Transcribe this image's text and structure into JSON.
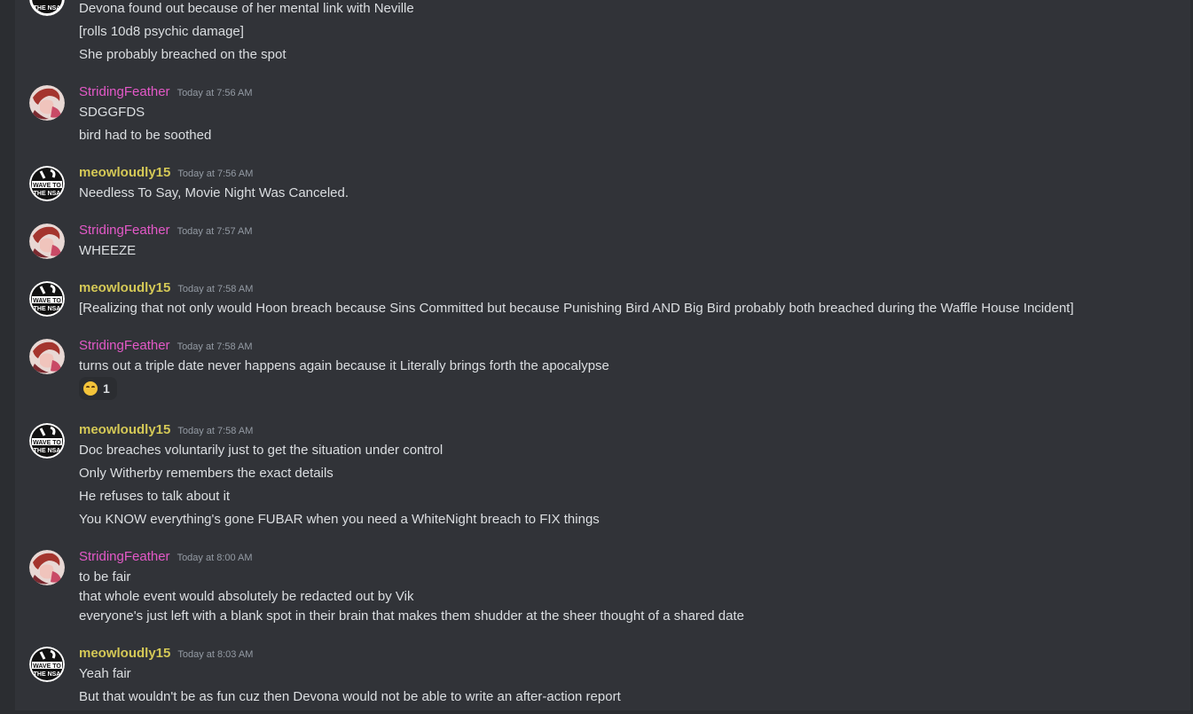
{
  "users": {
    "sf": "StridingFeather",
    "ml": "meowloudly15"
  },
  "avatars": {
    "nsa_badge_text": "WAVE TO THE NSA"
  },
  "colors": {
    "striding": "#e459c8",
    "meow": "#d4c856",
    "bg": "#313338"
  },
  "messages": [
    {
      "lines": [
        "Devona found out because of her mental link with Neville",
        "[rolls 10d8 psychic damage]",
        "She probably breached on the spot"
      ]
    },
    {
      "user": "StridingFeather",
      "time": "Today at 7:56 AM",
      "lines": [
        "SDGGFDS",
        "bird had to be soothed"
      ]
    },
    {
      "user": "meowloudly15",
      "time": "Today at 7:56 AM",
      "lines": [
        "Needless To Say, Movie Night Was Canceled."
      ]
    },
    {
      "user": "StridingFeather",
      "time": "Today at 7:57 AM",
      "lines": [
        "WHEEZE"
      ]
    },
    {
      "user": "meowloudly15",
      "time": "Today at 7:58 AM",
      "lines": [
        "[Realizing that not only would Hoon breach because Sins Committed but because Punishing Bird AND Big Bird probably both breached during the Waffle House Incident]"
      ]
    },
    {
      "user": "StridingFeather",
      "time": "Today at 7:58 AM",
      "lines": [
        "turns out a triple date never happens again because it Literally brings forth the apocalypse"
      ],
      "reaction": {
        "emoji": "grinning-cat-emoji",
        "count": "1"
      }
    },
    {
      "user": "meowloudly15",
      "time": "Today at 7:58 AM",
      "lines": [
        "Doc breaches voluntarily just to get the situation under control",
        "Only Witherby remembers the exact details",
        "He refuses to talk about it",
        "You KNOW everything's gone FUBAR when you need a WhiteNight breach to FIX things"
      ]
    },
    {
      "user": "StridingFeather",
      "time": "Today at 8:00 AM",
      "lines": [
        "to be fair",
        "that whole event would absolutely be redacted out by Vik",
        "everyone's just left with a blank spot in their brain that makes them shudder at the sheer thought of a shared date"
      ]
    },
    {
      "user": "meowloudly15",
      "time": "Today at 8:03 AM",
      "lines": [
        "Yeah fair",
        "But that wouldn't be as fun cuz then Devona would not be able to write an after-action report"
      ]
    }
  ]
}
